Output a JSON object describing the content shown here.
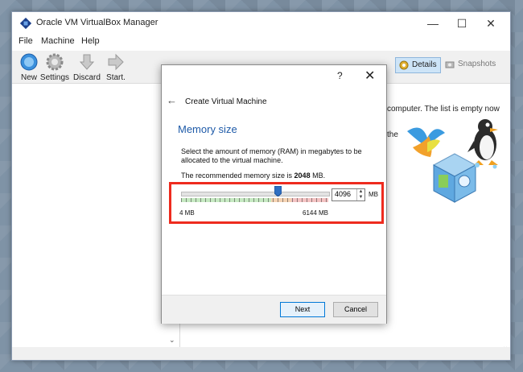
{
  "window": {
    "title": "Oracle VM VirtualBox Manager",
    "minimize": "—",
    "maximize": "☐",
    "close": "✕"
  },
  "menu": [
    "File",
    "Machine",
    "Help"
  ],
  "toolbar": {
    "new_label": "New",
    "settings_label": "Settings",
    "discard_label": "Discard",
    "start_label": "Start.",
    "details_label": "Details",
    "snapshots_label": "Snapshots"
  },
  "welcome": {
    "line1": "computer. The list is empty now",
    "line2": "the"
  },
  "dialog": {
    "help": "?",
    "close": "✕",
    "back": "←",
    "title": "Create Virtual Machine",
    "heading": "Memory size",
    "description": "Select the amount of memory (RAM) in megabytes to be allocated to the virtual machine.",
    "recommended_prefix": "The recommended memory size is ",
    "recommended_value": "2048",
    "recommended_suffix": " MB.",
    "memory_value": "4096",
    "memory_unit": "MB",
    "slider_min_label": "4 MB",
    "slider_max_label": "6144 MB",
    "slider_fraction": 0.6667,
    "next_label": "Next",
    "cancel_label": "Cancel"
  },
  "colors": {
    "accent": "#1e5aa8",
    "highlight": "#ee2b1e",
    "thumb": "#2f6fc2"
  },
  "icons": [
    "virtualbox-icon",
    "new-icon",
    "settings-gear-icon",
    "discard-arrow-icon",
    "start-arrow-icon",
    "details-gear-icon",
    "snapshots-camera-icon",
    "back-arrow-icon",
    "close-icon",
    "help-icon"
  ]
}
